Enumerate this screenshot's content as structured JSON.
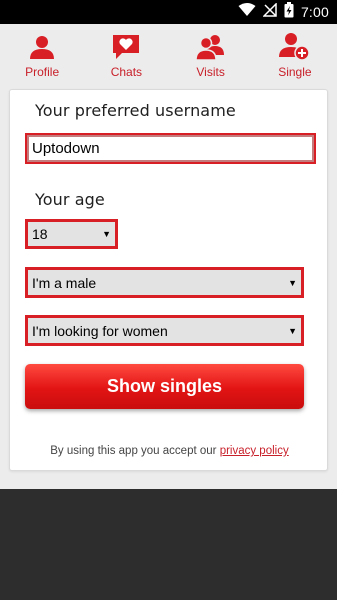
{
  "status": {
    "time": "7:00"
  },
  "nav": {
    "items": [
      {
        "label": "Profile",
        "icon": "profile-icon"
      },
      {
        "label": "Chats",
        "icon": "chat-heart-icon"
      },
      {
        "label": "Visits",
        "icon": "visits-icon"
      },
      {
        "label": "Single",
        "icon": "add-user-icon"
      }
    ]
  },
  "form": {
    "username_label": "Your preferred username",
    "username_value": "Uptodown",
    "age_label": "Your age",
    "age_value": "18",
    "gender_value": "I'm a male",
    "looking_for_value": "I'm looking for women",
    "submit_label": "Show singles"
  },
  "terms": {
    "text": "By using this app you accept our",
    "link": "privacy policy"
  },
  "colors": {
    "accent": "#d81f26",
    "nav": "#c8202a"
  }
}
